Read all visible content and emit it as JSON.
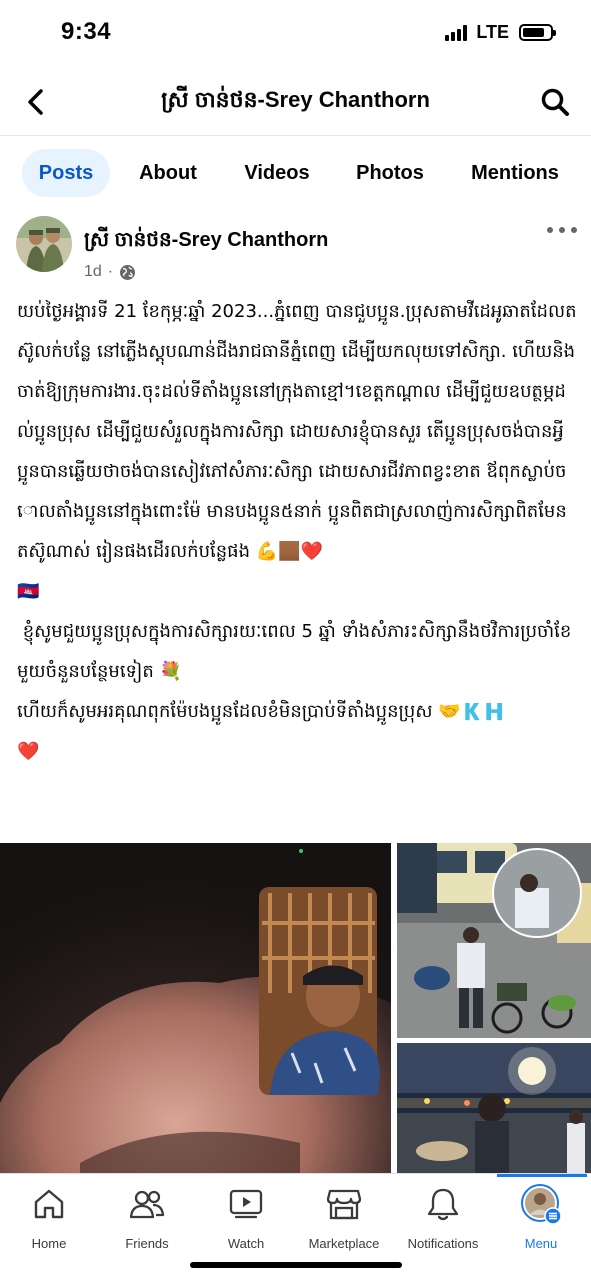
{
  "status_bar": {
    "time": "9:34",
    "network": "LTE",
    "signal_bars": 4,
    "battery_level": 0.8
  },
  "header": {
    "title": "ស្រី ចាន់ថន-Srey Chanthorn",
    "back_icon": "chevron-left-icon",
    "search_icon": "search-icon"
  },
  "tabs": [
    {
      "label": "Posts",
      "active": true
    },
    {
      "label": "About",
      "active": false
    },
    {
      "label": "Videos",
      "active": false
    },
    {
      "label": "Photos",
      "active": false
    },
    {
      "label": "Mentions",
      "active": false
    }
  ],
  "post": {
    "author": "ស្រី ចាន់ថន-Srey Chanthorn",
    "time": "1d",
    "separator": "·",
    "privacy_icon": "globe-icon",
    "more_icon": "more-horizontal-icon",
    "paragraphs": [
      "យប់ថ្ងៃអង្គារទី 21 ខែកុម្ភៈឆ្នាំ 2023...ភ្នំពេញ បានជួបប្អូន.ប្រុសតាមវីដេអូឆាតដែលតស៊ូលក់បន្លែ នៅភ្លើងស្តុបណាន់ជីងរាជធានីភ្នំពេញ ដើម្បីយកលុយទៅសិក្សា. ហើយនិងចាត់ឱ្យក្រុមការងារ.ចុះដល់ទីតាំងប្អូននៅក្រុងតាខ្មៅ។ខេត្តកណ្តាល ដើម្បីជួយឧបត្ថម្ភដល់ប្អូនប្រុស ដើម្បីជួយសំរួលក្នុងការសិក្សា ដោយសារខ្ញុំបានសួរ តើប្អូនប្រុសចង់បានអ្វី ប្អូនបានឆ្លើយថាចង់បានសៀវភៅសំភារៈសិក្សា ដោយសារជីវភាពខ្វះខាត ឪពុកស្លាប់ចោលតាំងប្អូននៅក្នុងពោះម៉ែ មានបងប្អូន៥នាក់ ប្អូនពិតជាស្រលាញ់ការសិក្សាពិតមែនតស៊ូណាស់ រៀនផងដើរលក់បន្លែផង 💪🏾❤️",
      "🇰🇭",
      " ខ្ញុំសូមជួយប្អូនប្រុសក្នុងការសិក្សារយៈពេល 5 ឆ្នាំ ទាំងសំភារះសិក្សានឹងថវិការប្រចាំខែមួយចំនួនបន្ថែមទៀត 💐",
      "ហើយក៏សូមអរគុណពុកម៉ែបងប្អូនដែលខំមិនប្រាប់ទីតាំងប្អូនប្រុស 🤝🇰🇭",
      "❤️"
    ]
  },
  "media": {
    "main": "video-call-photo",
    "top_right": "street-vendor-photo",
    "bottom_right": "night-street-photo"
  },
  "bottom_nav": [
    {
      "label": "Home",
      "icon": "home-icon",
      "active": false
    },
    {
      "label": "Friends",
      "icon": "friends-icon",
      "active": false
    },
    {
      "label": "Watch",
      "icon": "watch-icon",
      "active": false
    },
    {
      "label": "Marketplace",
      "icon": "marketplace-icon",
      "active": false
    },
    {
      "label": "Notifications",
      "icon": "bell-icon",
      "active": false
    },
    {
      "label": "Menu",
      "icon": "menu-icon",
      "active": true
    }
  ],
  "colors": {
    "accent": "#1877f2",
    "active_tab_bg": "#e7f3ff",
    "secondary_text": "#65676b"
  }
}
